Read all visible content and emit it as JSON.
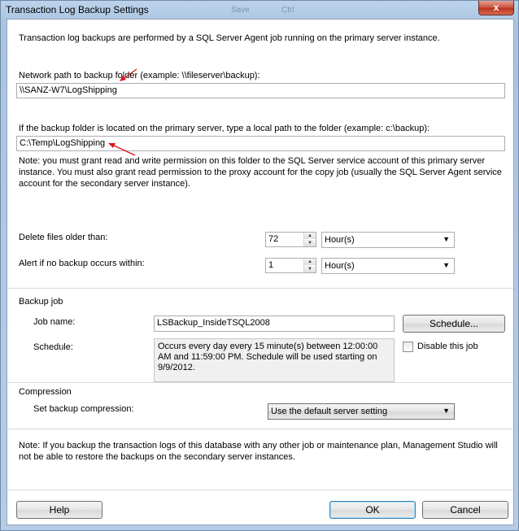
{
  "window": {
    "title": "Transaction Log Backup Settings",
    "close_label": "x",
    "background_ghost": [
      "Save",
      "Ctrl"
    ]
  },
  "intro": "Transaction log backups are performed by a SQL Server Agent job running on the primary server instance.",
  "network_path": {
    "label": "Network path to backup folder (example: \\\\fileserver\\backup):",
    "value": "\\\\SANZ-W7\\LogShipping"
  },
  "local_path": {
    "label": "If the backup folder is located on the primary server, type a local path to the folder (example: c:\\backup):",
    "value": "C:\\Temp\\LogShipping"
  },
  "permission_note": "Note: you must grant read and write permission on this folder to the SQL Server service account of this primary server instance. You must also grant read permission to the proxy account for the copy job (usually the SQL Server Agent service account for the secondary server instance).",
  "delete_files": {
    "label": "Delete files older than:",
    "value": "72",
    "unit": "Hour(s)"
  },
  "alert": {
    "label": "Alert if no backup occurs within:",
    "value": "1",
    "unit": "Hour(s)"
  },
  "backup_job": {
    "section_label": "Backup job",
    "job_name_label": "Job name:",
    "job_name_value": "LSBackup_InsideTSQL2008",
    "schedule_button": "Schedule...",
    "schedule_label": "Schedule:",
    "schedule_text": "Occurs every day every 15 minute(s) between 12:00:00 AM and 11:59:00 PM. Schedule will be used starting on 9/9/2012.",
    "disable_label": "Disable this job"
  },
  "compression": {
    "section_label": "Compression",
    "label": "Set backup compression:",
    "value": "Use the default server setting"
  },
  "restore_note": "Note: If you backup the transaction logs of this database with any other job or maintenance plan, Management Studio will not be able to restore the backups on the secondary server instances.",
  "buttons": {
    "help": "Help",
    "ok": "OK",
    "cancel": "Cancel"
  },
  "colors": {
    "annotation_arrow": "#e0141c",
    "window_frame": "#a9c4e1",
    "close_button": "#c9513c"
  }
}
